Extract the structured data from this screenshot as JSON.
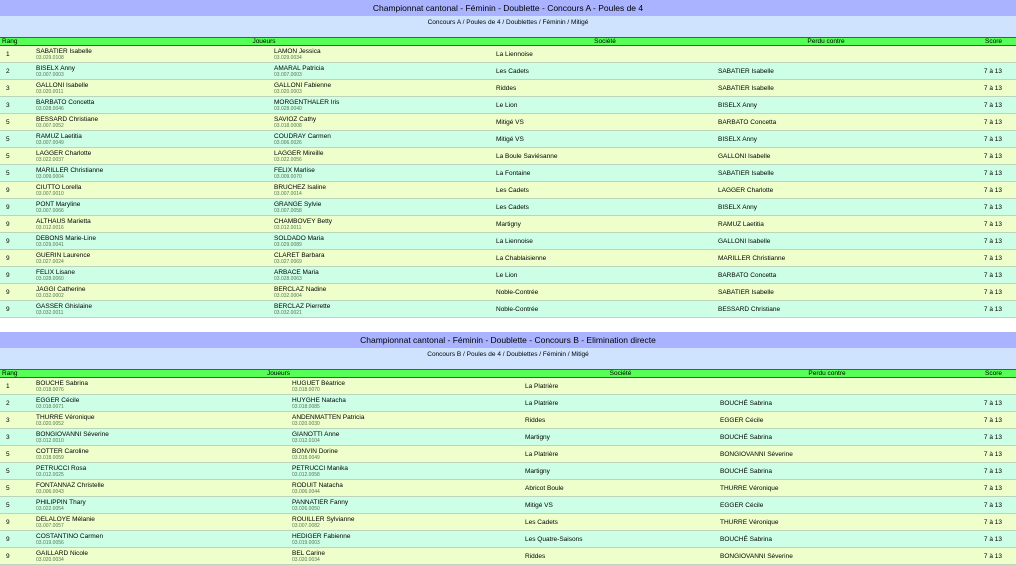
{
  "sectionA": {
    "title": "Championnat cantonal - Féminin - Doublette - Concours A - Poules de 4",
    "subtitle": "Concours A / Poules de 4 / Doublettes / Féminin / Mitigé",
    "headers": {
      "rang": "Rang",
      "joueurs": "Joueurs",
      "societe": "Société",
      "perdu": "Perdu contre",
      "score": "Score"
    },
    "rows": [
      {
        "rang": "1",
        "p1": "SABATIER Isabelle",
        "l1": "03.029.0108",
        "p2": "LAMON Jessica",
        "l2": "03.029.0034",
        "societe": "La Liennoise",
        "perdu": "",
        "score": ""
      },
      {
        "rang": "2",
        "p1": "BISELX Anny",
        "l1": "03.007.0003",
        "p2": "AMARAL Patricia",
        "l2": "03.007.0003",
        "societe": "Les Cadets",
        "perdu": "SABATIER Isabelle",
        "score": "7 à 13"
      },
      {
        "rang": "3",
        "p1": "GALLONI Isabelle",
        "l1": "03.020.0011",
        "p2": "GALLONI Fabienne",
        "l2": "03.020.0003",
        "societe": "Riddes",
        "perdu": "SABATIER Isabelle",
        "score": "7 à 13"
      },
      {
        "rang": "3",
        "p1": "BARBATO Concetta",
        "l1": "03.028.0046",
        "p2": "MORGENTHALER Iris",
        "l2": "03.028.0040",
        "societe": "Le Lion",
        "perdu": "BISELX Anny",
        "score": "7 à 13"
      },
      {
        "rang": "5",
        "p1": "BESSARD Christiane",
        "l1": "03.007.0052",
        "p2": "SAVIOZ Cathy",
        "l2": "03.018.0008",
        "societe": "Mitigé VS",
        "perdu": "BARBATO Concetta",
        "score": "7 à 13"
      },
      {
        "rang": "5",
        "p1": "RAMUZ Laetitia",
        "l1": "03.007.0049",
        "p2": "COUDRAY Carmen",
        "l2": "03.006.0026",
        "societe": "Mitigé VS",
        "perdu": "BISELX Anny",
        "score": "7 à 13"
      },
      {
        "rang": "5",
        "p1": "LAGGER Charlotte",
        "l1": "03.022.0037",
        "p2": "LAGGER Mireille",
        "l2": "03.022.0056",
        "societe": "La Boule Saviésanne",
        "perdu": "GALLONI Isabelle",
        "score": "7 à 13"
      },
      {
        "rang": "5",
        "p1": "MARILLER Christianne",
        "l1": "03.009.0004",
        "p2": "FELIX Marlise",
        "l2": "03.009.0070",
        "societe": "La Fontaine",
        "perdu": "SABATIER Isabelle",
        "score": "7 à 13"
      },
      {
        "rang": "9",
        "p1": "CIUTTO Lorella",
        "l1": "03.007.0010",
        "p2": "BRUCHEZ Isaline",
        "l2": "03.007.0014",
        "societe": "Les Cadets",
        "perdu": "LAGGER Charlotte",
        "score": "7 à 13"
      },
      {
        "rang": "9",
        "p1": "PONT Maryline",
        "l1": "03.007.0066",
        "p2": "GRANGE Sylvie",
        "l2": "03.007.0058",
        "societe": "Les Cadets",
        "perdu": "BISELX Anny",
        "score": "7 à 13"
      },
      {
        "rang": "9",
        "p1": "ALTHAUS Marietta",
        "l1": "03.012.0016",
        "p2": "CHAMBOVEY Betty",
        "l2": "03.012.0011",
        "societe": "Martigny",
        "perdu": "RAMUZ Laetitia",
        "score": "7 à 13"
      },
      {
        "rang": "9",
        "p1": "DEBONS Marie-Line",
        "l1": "03.029.0041",
        "p2": "SOLDADO Maria",
        "l2": "03.029.0089",
        "societe": "La Liennoise",
        "perdu": "GALLONI Isabelle",
        "score": "7 à 13"
      },
      {
        "rang": "9",
        "p1": "GUERIN Laurence",
        "l1": "03.027.0024",
        "p2": "CLARET Barbara",
        "l2": "03.027.0069",
        "societe": "La Chablaisienne",
        "perdu": "MARILLER Christianne",
        "score": "7 à 13"
      },
      {
        "rang": "9",
        "p1": "FELIX Lisane",
        "l1": "03.028.0060",
        "p2": "ARBACE Maria",
        "l2": "03.028.0063",
        "societe": "Le Lion",
        "perdu": "BARBATO Concetta",
        "score": "7 à 13"
      },
      {
        "rang": "9",
        "p1": "JAGGI Catherine",
        "l1": "03.032.0002",
        "p2": "BERCLAZ Nadine",
        "l2": "03.032.0004",
        "societe": "Noble-Contrée",
        "perdu": "SABATIER Isabelle",
        "score": "7 à 13"
      },
      {
        "rang": "9",
        "p1": "GASSER Ghislaine",
        "l1": "03.032.0011",
        "p2": "BERCLAZ Pierrette",
        "l2": "03.032.0021",
        "societe": "Noble-Contrée",
        "perdu": "BESSARD Christiane",
        "score": "7 à 13"
      }
    ]
  },
  "sectionB": {
    "title": "Championnat cantonal - Féminin - Doublette - Concours B - Elimination directe",
    "subtitle": "Concours B / Poules de 4 / Doublettes / Féminin / Mitigé",
    "headers": {
      "rang": "Rang",
      "joueurs": "Joueurs",
      "societe": "Société",
      "perdu": "Perdu contre",
      "score": "Score"
    },
    "rows": [
      {
        "rang": "1",
        "p1": "BOUCHE Sabrina",
        "l1": "03.018.0076",
        "p2": "HUGUET Béatrice",
        "l2": "03.018.0070",
        "societe": "La Platrière",
        "perdu": "",
        "score": ""
      },
      {
        "rang": "2",
        "p1": "EGGER Cécile",
        "l1": "03.018.0071",
        "p2": "HUYGHE Natacha",
        "l2": "03.018.0085",
        "societe": "La Platrière",
        "perdu": "BOUCHÉ Sabrina",
        "score": "7 à 13"
      },
      {
        "rang": "3",
        "p1": "THURRE Véronique",
        "l1": "03.020.0052",
        "p2": "ANDENMATTEN Patricia",
        "l2": "03.020.0030",
        "societe": "Riddes",
        "perdu": "EGGER Cécile",
        "score": "7 à 13"
      },
      {
        "rang": "3",
        "p1": "BONGIOVANNI Séverine",
        "l1": "03.012.0010",
        "p2": "GIANOTTI Anne",
        "l2": "03.012.0104",
        "societe": "Martigny",
        "perdu": "BOUCHÉ Sabrina",
        "score": "7 à 13"
      },
      {
        "rang": "5",
        "p1": "COTTER Caroline",
        "l1": "03.018.0059",
        "p2": "BONVIN Dorine",
        "l2": "03.018.0049",
        "societe": "La Platrière",
        "perdu": "BONGIOVANNI Séverine",
        "score": "7 à 13"
      },
      {
        "rang": "5",
        "p1": "PETRUCCI Rosa",
        "l1": "03.012.0025",
        "p2": "PETRUCCI Manika",
        "l2": "03.012.0058",
        "societe": "Martigny",
        "perdu": "BOUCHÉ Sabrina",
        "score": "7 à 13"
      },
      {
        "rang": "5",
        "p1": "FONTANNAZ Christelle",
        "l1": "03.006.0043",
        "p2": "RODUIT Natacha",
        "l2": "03.006.0044",
        "societe": "Abricot Boule",
        "perdu": "THURRE Véronique",
        "score": "7 à 13"
      },
      {
        "rang": "5",
        "p1": "PHILIPPIN Thary",
        "l1": "03.022.0054",
        "p2": "PANNATIER Fanny",
        "l2": "03.026.0050",
        "societe": "Mitigé VS",
        "perdu": "EGGER Cécile",
        "score": "7 à 13"
      },
      {
        "rang": "9",
        "p1": "DELALOYE Mélanie",
        "l1": "03.007.0057",
        "p2": "ROUILLER Sylvianne",
        "l2": "03.007.0082",
        "societe": "Les Cadets",
        "perdu": "THURRE Véronique",
        "score": "7 à 13"
      },
      {
        "rang": "9",
        "p1": "COSTANTINO Carmen",
        "l1": "03.019.0056",
        "p2": "HEDIGER Fabienne",
        "l2": "03.019.0003",
        "societe": "Les Quatre-Saisons",
        "perdu": "BOUCHÉ Sabrina",
        "score": "7 à 13"
      },
      {
        "rang": "9",
        "p1": "GAILLARD Nicole",
        "l1": "03.020.0034",
        "p2": "BEL Carine",
        "l2": "03.020.0034",
        "societe": "Riddes",
        "perdu": "BONGIOVANNI Séverine",
        "score": "7 à 13"
      }
    ]
  }
}
